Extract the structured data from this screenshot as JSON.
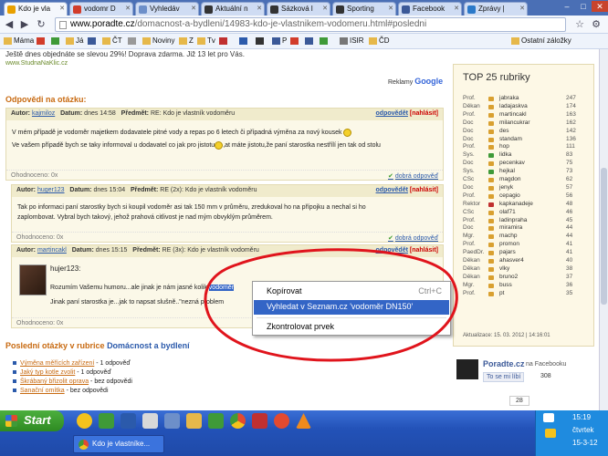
{
  "browser": {
    "tabs": [
      {
        "label": "Kdo je vla",
        "color": "#e8a000",
        "active": true
      },
      {
        "label": "vodomr D",
        "color": "#d23c2a"
      },
      {
        "label": "Vyhledáv",
        "color": "#6d8fc9"
      },
      {
        "label": "Aktuální n",
        "color": "#333333"
      },
      {
        "label": "Sázková l",
        "color": "#333333"
      },
      {
        "label": "Sporting",
        "color": "#333333"
      },
      {
        "label": "Facebook",
        "color": "#3b5998"
      },
      {
        "label": "Zprávy |",
        "color": "#2b79c9"
      }
    ],
    "url_host": "www.poradte.cz",
    "url_path": "/domacnost-a-bydleni/14983-kdo-je-vlastnikem-vodomeru.html#posledni",
    "bookmarks": [
      {
        "label": "Máma",
        "color": "#e6b84a"
      },
      {
        "label": "",
        "color": "#d23c2a"
      },
      {
        "label": "",
        "color": "#3f9a38"
      },
      {
        "label": "Já",
        "color": "#e6b84a"
      },
      {
        "label": "",
        "color": "#3b5998"
      },
      {
        "label": "ČT",
        "color": "#e6b84a"
      },
      {
        "label": "",
        "color": "#999999"
      },
      {
        "label": "Noviny",
        "color": "#e6b84a"
      },
      {
        "label": "Z",
        "color": "#e6b84a"
      },
      {
        "label": "Tv",
        "color": "#e6b84a"
      },
      {
        "label": "",
        "color": "#c03030"
      },
      {
        "label": "",
        "color": "#2b5aab"
      },
      {
        "label": "",
        "color": "#333333"
      },
      {
        "label": "P",
        "color": "#3b5998"
      },
      {
        "label": "",
        "color": "#d23c2a"
      },
      {
        "label": "",
        "color": "#3b5998"
      },
      {
        "label": "",
        "color": "#3f9a38"
      },
      {
        "label": "ISIR",
        "color": "#777777"
      },
      {
        "label": "ČD",
        "color": "#e6b84a"
      },
      {
        "label": "Ostatní záložky",
        "color": "#e6b84a"
      }
    ]
  },
  "page": {
    "ad_text": "Ještě dnes objednáte se slevou 29%! Doprava zdarma. Již 13 let pro Vás.",
    "ad_link": "www.StudnaNaKlic.cz",
    "ads_by": "Reklamy",
    "ads_brand": "Google",
    "answers_title": "Odpovědi na otázku:",
    "labels": {
      "author": "Autor:",
      "date": "Datum:",
      "subject": "Předmět:",
      "reply": "odpovědět",
      "report": "[nahlásit]",
      "thanked": "Ohodnoceno: 0x",
      "good": "dobrá odpověď"
    },
    "answers": [
      {
        "author": "kajmiloz",
        "date": "dnes 14:58",
        "subject": "RE: Kdo je vlastník vodoměru",
        "body1": "V mém případě je vodoměr majetkem dodavatele pitné vody a repas po 6 letech či případná výměna za nový kousek",
        "body2a": "Ve vašem případě bych se taky informoval u dodavatel co jak pro jistotu",
        "body2b": ",at máte jistotu,že paní starostka nestřílí jen tak od stolu"
      },
      {
        "author": "huger123",
        "date": "dnes 15:04",
        "subject": "RE (2x): Kdo je vlastník vodoměru",
        "body1": "Tak po informaci paní starostky bych si koupil vodoměr asi tak 150 mm v průměru, zredukoval ho na přípojku a nechal si ho",
        "body2": "zaplombovat. Vybral bych takový, jehož prahová citlivost je nad mým obvyklým průměrem."
      },
      {
        "author": "martincakl",
        "date": "dnes 15:15",
        "subject": "RE (3x): Kdo je vlastník vodoměru",
        "quote": "hujer123:",
        "body1": "Rozumím Vašemu humoru...ale jinak je nám jasné kolik",
        "sel": "vodoměr",
        "body2": "Jinak paní starostka je...jak to napsat slušně..\"nezná",
        "body2b": "problem"
      }
    ],
    "last_title_a": "Poslední otázky v rubrice",
    "last_title_b": "Domácnost a bydlení",
    "last_items": [
      {
        "q": "Výměna měřících zařízení",
        "tail": " - 1 odpověď"
      },
      {
        "q": "Jaký typ kotle zvolit",
        "tail": " - 1 odpověď"
      },
      {
        "q": "Škrábaný břizolit oprava",
        "tail": " - bez odpovědi"
      },
      {
        "q": "Sanační omítka",
        "tail": " - bez odpovědi"
      }
    ]
  },
  "sidebar": {
    "title": "TOP 25 rubriky",
    "rows": [
      {
        "r": "Prof.",
        "n": "jabraka",
        "v": "247",
        "c": "#d9a030"
      },
      {
        "r": "Děkan",
        "n": "ladajaskva",
        "v": "174",
        "c": "#d9a030"
      },
      {
        "r": "Prof.",
        "n": "martincakl",
        "v": "163",
        "c": "#d9a030"
      },
      {
        "r": "Doc",
        "n": "milancukrar",
        "v": "162",
        "c": "#d9a030"
      },
      {
        "r": "Doc",
        "n": "des",
        "v": "142",
        "c": "#d9a030"
      },
      {
        "r": "Doc",
        "n": "standam",
        "v": "136",
        "c": "#d9a030"
      },
      {
        "r": "Prof.",
        "n": "hop",
        "v": "111",
        "c": "#d9a030"
      },
      {
        "r": "Sys.",
        "n": "lidka",
        "v": "83",
        "c": "#3f9a38"
      },
      {
        "r": "Doc",
        "n": "pecenkav",
        "v": "75",
        "c": "#d9a030"
      },
      {
        "r": "Sys.",
        "n": "hejkal",
        "v": "73",
        "c": "#3f9a38"
      },
      {
        "r": "CSc",
        "n": "magdon",
        "v": "62",
        "c": "#d9a030"
      },
      {
        "r": "Doc",
        "n": "jenyk",
        "v": "57",
        "c": "#d9a030"
      },
      {
        "r": "Prof.",
        "n": "cepagio",
        "v": "56",
        "c": "#d9a030"
      },
      {
        "r": "Rektor",
        "n": "kapkanadeje",
        "v": "48",
        "c": "#c03030"
      },
      {
        "r": "CSc",
        "n": "olaf71",
        "v": "46",
        "c": "#d9a030"
      },
      {
        "r": "Prof.",
        "n": "ladinpraha",
        "v": "45",
        "c": "#d9a030"
      },
      {
        "r": "Doc",
        "n": "miramira",
        "v": "44",
        "c": "#d9a030"
      },
      {
        "r": "Mgr.",
        "n": "machp",
        "v": "44",
        "c": "#d9a030"
      },
      {
        "r": "Prof.",
        "n": "promon",
        "v": "41",
        "c": "#d9a030"
      },
      {
        "r": "PaedDr.",
        "n": "pajars",
        "v": "41",
        "c": "#d9a030"
      },
      {
        "r": "Děkan",
        "n": "ahasver4",
        "v": "40",
        "c": "#d9a030"
      },
      {
        "r": "Děkan",
        "n": "vlky",
        "v": "38",
        "c": "#d9a030"
      },
      {
        "r": "Děkan",
        "n": "bruno2",
        "v": "37",
        "c": "#d9a030"
      },
      {
        "r": "Mgr.",
        "n": "buss",
        "v": "36",
        "c": "#d9a030"
      },
      {
        "r": "Prof.",
        "n": "pt",
        "v": "35",
        "c": "#d9a030"
      }
    ],
    "updated": "Aktualizace: 15. 03. 2012 | 14:16:01",
    "fb_name": "Poradte.cz",
    "fb_on": "na Facebooku",
    "fb_like": "To se mi líbí",
    "fb_count": "308",
    "fb_small": "28"
  },
  "context_menu": {
    "copy": "Kopírovat",
    "copy_shortcut": "Ctrl+C",
    "search": "Vyhledat v Seznam.cz 'vodoměr DN150'",
    "spell": "Zkontrolovat prvek"
  },
  "taskbar": {
    "start": "Start",
    "task": "Kdo je vlastníke...",
    "time": "15:19",
    "day": "čtvrtek",
    "date": "15-3-12"
  }
}
